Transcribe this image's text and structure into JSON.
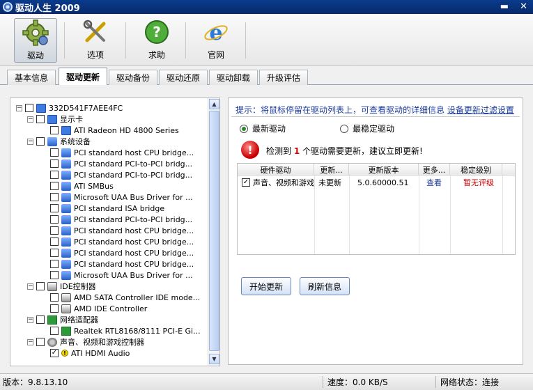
{
  "window": {
    "title": "驱动人生 2009",
    "minimize": "▬",
    "close": "✕"
  },
  "toolbar": {
    "items": [
      {
        "label": "驱动",
        "icon": "gear-icon"
      },
      {
        "label": "选项",
        "icon": "tools-icon"
      },
      {
        "label": "求助",
        "icon": "help-icon"
      },
      {
        "label": "官网",
        "icon": "internet-explorer-icon"
      }
    ]
  },
  "tabs": [
    {
      "label": "基本信息"
    },
    {
      "label": "驱动更新"
    },
    {
      "label": "驱动备份"
    },
    {
      "label": "驱动还原"
    },
    {
      "label": "驱动卸载"
    },
    {
      "label": "升级评估"
    }
  ],
  "tree": {
    "nodes": [
      {
        "label": "332D541F7AEE4FC",
        "level": 0,
        "icon": "computer-icon",
        "expand": "−",
        "checked": false
      },
      {
        "label": "显示卡",
        "level": 1,
        "icon": "monitor-icon",
        "expand": "−",
        "checked": false
      },
      {
        "label": "ATI Radeon HD 4800 Series",
        "level": 2,
        "icon": "monitor-icon",
        "checked": false
      },
      {
        "label": "系统设备",
        "level": 1,
        "icon": "chip-icon",
        "expand": "−",
        "checked": false
      },
      {
        "label": "PCI standard host CPU bridge...",
        "level": 2,
        "icon": "chip-icon",
        "checked": false
      },
      {
        "label": "PCI standard PCI-to-PCI bridg...",
        "level": 2,
        "icon": "chip-icon",
        "checked": false
      },
      {
        "label": "PCI standard PCI-to-PCI bridg...",
        "level": 2,
        "icon": "chip-icon",
        "checked": false
      },
      {
        "label": "ATI SMBus",
        "level": 2,
        "icon": "chip-icon",
        "checked": false
      },
      {
        "label": "Microsoft UAA Bus Driver for ...",
        "level": 2,
        "icon": "chip-icon",
        "checked": false
      },
      {
        "label": "PCI standard ISA bridge",
        "level": 2,
        "icon": "chip-icon",
        "checked": false
      },
      {
        "label": "PCI standard PCI-to-PCI bridg...",
        "level": 2,
        "icon": "chip-icon",
        "checked": false
      },
      {
        "label": "PCI standard host CPU bridge...",
        "level": 2,
        "icon": "chip-icon",
        "checked": false
      },
      {
        "label": "PCI standard host CPU bridge...",
        "level": 2,
        "icon": "chip-icon",
        "checked": false
      },
      {
        "label": "PCI standard host CPU bridge...",
        "level": 2,
        "icon": "chip-icon",
        "checked": false
      },
      {
        "label": "PCI standard host CPU bridge...",
        "level": 2,
        "icon": "chip-icon",
        "checked": false
      },
      {
        "label": "Microsoft UAA Bus Driver for ...",
        "level": 2,
        "icon": "chip-icon",
        "checked": false
      },
      {
        "label": "IDE控制器",
        "level": 1,
        "icon": "drive-icon",
        "expand": "−",
        "checked": false
      },
      {
        "label": "AMD SATA Controller IDE mode...",
        "level": 2,
        "icon": "drive-icon",
        "checked": false
      },
      {
        "label": "AMD IDE Controller",
        "level": 2,
        "icon": "drive-icon",
        "checked": false
      },
      {
        "label": "网络适配器",
        "level": 1,
        "icon": "network-card-icon",
        "expand": "−",
        "checked": false
      },
      {
        "label": "Realtek RTL8168/8111 PCI-E Gi...",
        "level": 2,
        "icon": "network-card-icon",
        "checked": false
      },
      {
        "label": "声音、视频和游戏控制器",
        "level": 1,
        "icon": "speaker-icon",
        "expand": "−",
        "checked": false
      },
      {
        "label": "ATI HDMI Audio",
        "level": 2,
        "icon": "warning-icon",
        "checked": true
      }
    ]
  },
  "panel": {
    "hint": "提示：将鼠标停留在驱动列表上，可查看驱动的详细信息",
    "filter_link": "设备更新过滤设置",
    "radio_latest": "最新驱动",
    "radio_stable": "最稳定驱动",
    "alert_prefix": "检测到",
    "alert_count": "1",
    "alert_suffix": "个驱动需要更新，建议立即更新!",
    "columns": [
      "硬件驱动",
      "更新...",
      "更新版本",
      "更多...",
      "稳定级别"
    ],
    "rows": [
      {
        "name": "声音、视频和游戏",
        "status": "未更新",
        "version": "5.0.60000.51",
        "more": "查看",
        "level": "暂无评级",
        "checked": true
      }
    ],
    "btn_update": "开始更新",
    "btn_refresh": "刷新信息"
  },
  "status": {
    "version": "版本：9.8.13.10",
    "speed": "速度：0.0 KB/S",
    "network": "网络状态：连接"
  },
  "colors": {
    "title_bar": "#0a3b8c",
    "link": "#1a3a9a",
    "alert": "#d00000"
  }
}
